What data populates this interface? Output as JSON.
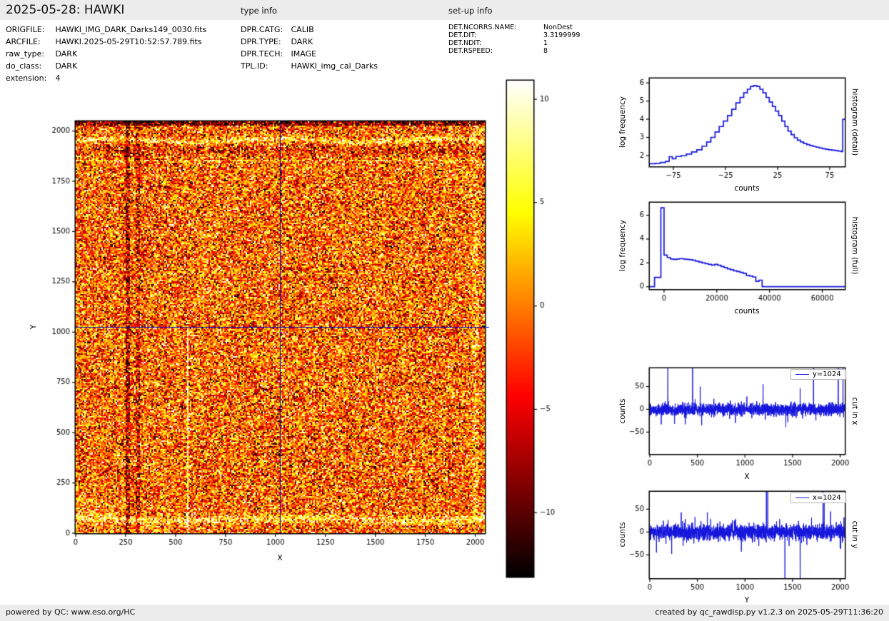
{
  "header": {
    "title": "2025-05-28: HAWKI",
    "type_info_label": "type info",
    "setup_info_label": "set-up info"
  },
  "metadata": {
    "file_info": [
      {
        "label": "ORIGFILE:",
        "value": "HAWKI_IMG_DARK_Darks149_0030.fits"
      },
      {
        "label": "ARCFILE:",
        "value": "HAWKI.2025-05-29T10:52:57.789.fits"
      },
      {
        "label": "raw_type:",
        "value": "DARK"
      },
      {
        "label": "do_class:",
        "value": "DARK"
      },
      {
        "label": "extension:",
        "value": "4"
      }
    ],
    "type_info": [
      {
        "label": "DPR.CATG:",
        "value": "CALIB"
      },
      {
        "label": "DPR.TYPE:",
        "value": "DARK"
      },
      {
        "label": "DPR.TECH:",
        "value": "IMAGE"
      },
      {
        "label": "TPL.ID:",
        "value": "HAWKI_img_cal_Darks"
      }
    ],
    "setup_info": [
      {
        "label": "DET.NCORRS.NAME:",
        "value": "NonDest"
      },
      {
        "label": "DET.DIT:",
        "value": "3.3199999"
      },
      {
        "label": "DET.NDIT:",
        "value": "1"
      },
      {
        "label": "DET.RSPEED:",
        "value": "8"
      }
    ]
  },
  "footer": {
    "left": "powered by QC: www.eso.org/HC",
    "right": "created by qc_rawdisp.py v1.2.3 on 2025-05-29T11:36:20"
  },
  "chart_data": [
    {
      "type": "heatmap",
      "xlabel": "X",
      "ylabel": "Y",
      "xlim": [
        0,
        2048
      ],
      "ylim": [
        0,
        2048
      ],
      "x_ticks": [
        0,
        250,
        500,
        750,
        1000,
        1250,
        1500,
        1750,
        2000
      ],
      "y_ticks": [
        0,
        250,
        500,
        750,
        1000,
        1250,
        1500,
        1750,
        2000
      ],
      "colormap": "hot",
      "colorbar": {
        "ticks": [
          10,
          5,
          0,
          -5,
          -10
        ],
        "vmin": -13.1,
        "vmax": 10.9
      },
      "crosshair": {
        "x": 1024,
        "y": 1024,
        "color": "#0000cc"
      },
      "noise": {
        "mean": -0.7,
        "sigma": 5.2,
        "seed": 42
      },
      "features": {
        "dark_top_rows_above_y": 2030,
        "bright_band_top_y": 1952,
        "dark_band_y": 1902,
        "thin_bright_rows_y": [
          1853,
          1292,
          1190
        ],
        "bright_band_bottom_y": 68,
        "dark_columns_x": [
          [
            248,
            270
          ],
          [
            298,
            322
          ]
        ],
        "white_column": {
          "x": 560,
          "y_max": 1030
        },
        "bright_column_x": 2000
      }
    },
    {
      "type": "step-histogram",
      "right_label": "histogram (detail)",
      "xlabel": "counts",
      "ylabel": "log frequency",
      "x_ticks": [
        -75,
        -25,
        25,
        75
      ],
      "y_ticks": [
        2,
        3,
        4,
        5,
        6
      ],
      "xlim": [
        -97.6,
        89.4
      ],
      "ylim": [
        1.41,
        6.24
      ],
      "line_color": "#1414dc",
      "steps": [
        [
          -97.6,
          1.55
        ],
        [
          -92.5,
          1.57
        ],
        [
          -87.5,
          1.62
        ],
        [
          -82.5,
          1.68
        ],
        [
          -79,
          1.94
        ],
        [
          -76,
          1.83
        ],
        [
          -72.5,
          1.95
        ],
        [
          -67.5,
          2.0
        ],
        [
          -62.5,
          2.08
        ],
        [
          -57.5,
          2.2
        ],
        [
          -52.5,
          2.32
        ],
        [
          -47.5,
          2.52
        ],
        [
          -43,
          2.75
        ],
        [
          -39,
          3.0
        ],
        [
          -35,
          3.3
        ],
        [
          -31,
          3.6
        ],
        [
          -27,
          3.9
        ],
        [
          -23,
          4.2
        ],
        [
          -19,
          4.55
        ],
        [
          -15,
          4.9
        ],
        [
          -11,
          5.2
        ],
        [
          -7.5,
          5.45
        ],
        [
          -4,
          5.65
        ],
        [
          -1,
          5.8
        ],
        [
          2,
          5.85
        ],
        [
          5,
          5.8
        ],
        [
          8,
          5.65
        ],
        [
          11,
          5.45
        ],
        [
          14,
          5.2
        ],
        [
          17,
          4.95
        ],
        [
          20,
          4.7
        ],
        [
          23,
          4.45
        ],
        [
          26,
          4.2
        ],
        [
          29,
          3.9
        ],
        [
          32,
          3.6
        ],
        [
          35,
          3.35
        ],
        [
          38,
          3.15
        ],
        [
          41,
          2.98
        ],
        [
          44,
          2.85
        ],
        [
          47,
          2.75
        ],
        [
          50,
          2.66
        ],
        [
          53,
          2.6
        ],
        [
          56,
          2.55
        ],
        [
          59,
          2.5
        ],
        [
          62,
          2.46
        ],
        [
          65,
          2.42
        ],
        [
          68,
          2.38
        ],
        [
          71,
          2.35
        ],
        [
          74,
          2.32
        ],
        [
          77,
          2.3
        ],
        [
          80,
          2.28
        ],
        [
          83,
          2.25
        ],
        [
          86,
          2.22
        ],
        [
          87.5,
          4.0
        ]
      ]
    },
    {
      "type": "step-histogram",
      "right_label": "histogram (full)",
      "xlabel": "counts",
      "ylabel": "log frequency",
      "x_ticks": [
        0,
        20000,
        40000,
        60000
      ],
      "y_ticks": [
        0,
        2,
        4,
        6
      ],
      "xlim": [
        -5400,
        68500
      ],
      "ylim": [
        -0.2,
        7.05
      ],
      "line_color": "#1414dc",
      "steps": [
        [
          -5400,
          0
        ],
        [
          -3600,
          0.78
        ],
        [
          -1200,
          6.62
        ],
        [
          0,
          2.65
        ],
        [
          1200,
          2.45
        ],
        [
          2400,
          2.33
        ],
        [
          3600,
          2.3
        ],
        [
          4800,
          2.33
        ],
        [
          6000,
          2.36
        ],
        [
          7200,
          2.33
        ],
        [
          8400,
          2.3
        ],
        [
          9600,
          2.27
        ],
        [
          10800,
          2.22
        ],
        [
          12000,
          2.15
        ],
        [
          13200,
          2.07
        ],
        [
          14400,
          2.0
        ],
        [
          15600,
          1.93
        ],
        [
          16800,
          1.87
        ],
        [
          18000,
          1.82
        ],
        [
          19200,
          1.88
        ],
        [
          20400,
          1.8
        ],
        [
          21600,
          1.7
        ],
        [
          22800,
          1.6
        ],
        [
          24000,
          1.5
        ],
        [
          25200,
          1.42
        ],
        [
          26400,
          1.33
        ],
        [
          27600,
          1.27
        ],
        [
          28800,
          1.2
        ],
        [
          30000,
          1.13
        ],
        [
          31200,
          0.95
        ],
        [
          32400,
          0.9
        ],
        [
          33600,
          0.82
        ],
        [
          34800,
          0.45
        ],
        [
          36000,
          0.55
        ],
        [
          37200,
          0
        ]
      ]
    },
    {
      "type": "line",
      "legend": "y=1024",
      "right_label": "cut in x",
      "xlabel": "X",
      "ylabel": "counts",
      "x_ticks": [
        0,
        500,
        1000,
        1500,
        2000
      ],
      "y_ticks": [
        -50,
        0,
        50
      ],
      "xlim": [
        0,
        2048
      ],
      "ylim": [
        -98,
        90
      ],
      "line_color": "#1414dc",
      "noise": {
        "sigma": 6.5,
        "seed": 101
      },
      "spikes": [
        [
          120,
          -33
        ],
        [
          190,
          130
        ],
        [
          260,
          -32
        ],
        [
          450,
          120
        ],
        [
          530,
          50
        ],
        [
          545,
          -35
        ],
        [
          900,
          -30
        ],
        [
          1020,
          28
        ],
        [
          1190,
          55
        ],
        [
          1450,
          -28
        ],
        [
          1580,
          46
        ],
        [
          1720,
          115
        ],
        [
          1980,
          112
        ],
        [
          2030,
          105
        ]
      ]
    },
    {
      "type": "line",
      "legend": "x=1024",
      "right_label": "cut in y",
      "xlabel": "Y",
      "ylabel": "counts",
      "x_ticks": [
        0,
        500,
        1000,
        1500,
        2000
      ],
      "y_ticks": [
        -50,
        0,
        50
      ],
      "xlim": [
        0,
        2048
      ],
      "ylim": [
        -101,
        88
      ],
      "line_color": "#1414dc",
      "noise": {
        "sigma": 8.5,
        "seed": 202
      },
      "spikes": [
        [
          70,
          -45
        ],
        [
          230,
          -48
        ],
        [
          330,
          43
        ],
        [
          350,
          -30
        ],
        [
          1225,
          145
        ],
        [
          1240,
          90
        ],
        [
          1420,
          -135
        ],
        [
          1580,
          -145
        ],
        [
          1650,
          -28
        ],
        [
          1820,
          125
        ],
        [
          1832,
          70
        ],
        [
          1900,
          45
        ],
        [
          2000,
          -35
        ],
        [
          2040,
          32
        ]
      ]
    }
  ]
}
